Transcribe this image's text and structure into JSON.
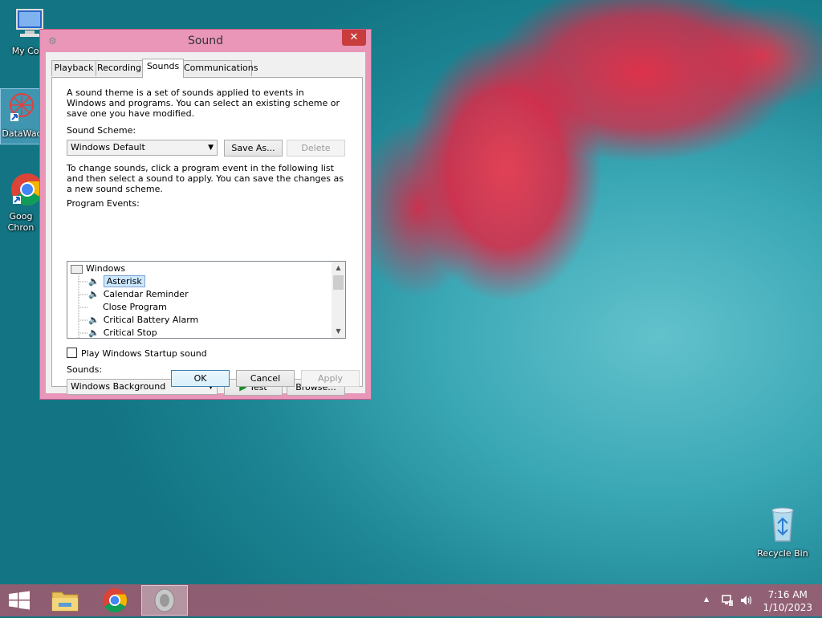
{
  "desktop": {
    "icons": [
      {
        "label": "My Com"
      },
      {
        "label": "DataWac"
      },
      {
        "label": "Goog Chron"
      },
      {
        "label": "Recycle Bin"
      }
    ]
  },
  "dialog": {
    "title": "Sound",
    "close_glyph": "✕",
    "tabs": [
      {
        "label": "Playback"
      },
      {
        "label": "Recording"
      },
      {
        "label": "Sounds",
        "active": true
      },
      {
        "label": "Communications"
      }
    ],
    "intro_text": "A sound theme is a set of sounds applied to events in Windows and programs.  You can select an existing scheme or save one you have modified.",
    "scheme_label": "Sound Scheme:",
    "scheme_value": "Windows Default",
    "save_as_label": "Save As...",
    "delete_label": "Delete",
    "instructions_text": "To change sounds, click a program event in the following list and then select a sound to apply.  You can save the changes as a new sound scheme.",
    "events_label": "Program Events:",
    "events": {
      "root": "Windows",
      "items": [
        {
          "label": "Asterisk",
          "selected": true,
          "has_sound": true
        },
        {
          "label": "Calendar Reminder",
          "has_sound": true
        },
        {
          "label": "Close Program",
          "has_sound": false
        },
        {
          "label": "Critical Battery Alarm",
          "has_sound": true
        },
        {
          "label": "Critical Stop",
          "has_sound": true
        }
      ]
    },
    "startup_checkbox_label": "Play Windows Startup sound",
    "startup_checked": false,
    "sounds_label": "Sounds:",
    "sounds_value": "Windows Background",
    "test_label": "Test",
    "browse_label": "Browse...",
    "ok_label": "OK",
    "cancel_label": "Cancel",
    "apply_label": "Apply"
  },
  "taskbar": {
    "time": "7:16 AM",
    "date": "1/10/2023",
    "tray_chevron": "▲"
  },
  "colors": {
    "dialog_frame": "#e996b9",
    "taskbar": "#a05a6e",
    "selection": "#cce8ff"
  }
}
